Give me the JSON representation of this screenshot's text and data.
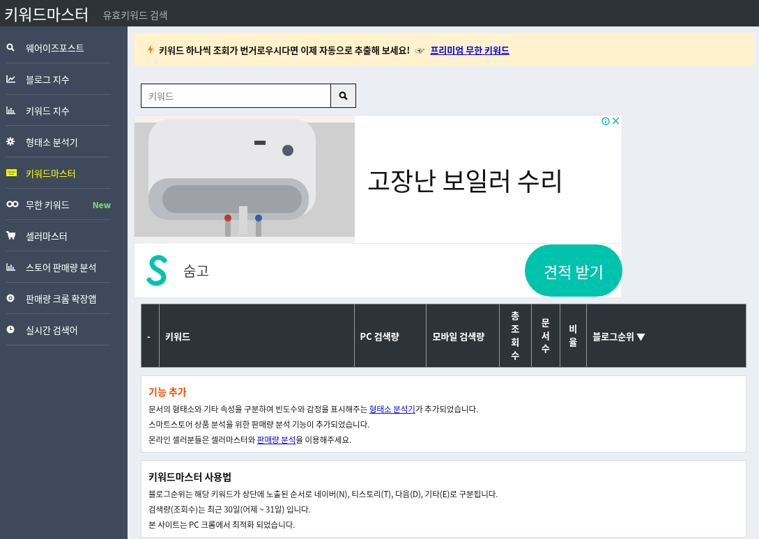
{
  "header": {
    "title": "키워드마스터",
    "subtitle": "유효키워드 검색"
  },
  "sidebar": {
    "items": [
      {
        "label": "웨어이즈포스트",
        "selected": false
      },
      {
        "label": "블로그 지수",
        "selected": false
      },
      {
        "label": "키워드 지수",
        "selected": false
      },
      {
        "label": "형태소 분석기",
        "selected": false
      },
      {
        "label": "키워드마스터",
        "selected": true
      },
      {
        "label": "무한 키워드",
        "selected": false,
        "badge": "New"
      },
      {
        "label": "셀러마스터",
        "selected": false
      },
      {
        "label": "스토어 판매량 분석",
        "selected": false
      },
      {
        "label": "판매량 크롬 확장앱",
        "selected": false
      },
      {
        "label": "실시간 검색어",
        "selected": false
      }
    ]
  },
  "banner": {
    "text": "키워드 하나씩 조회가 번거로우시다면 이제 자동으로 추출해 보세요!",
    "pointer": "☞",
    "link": "프리미엄 무한 키워드"
  },
  "search": {
    "placeholder": "키워드"
  },
  "ad": {
    "headline": "고장난 보일러 수리",
    "brand": "숨고",
    "button": "견적 받기"
  },
  "table": {
    "columns": [
      {
        "label": "-",
        "vertical": false
      },
      {
        "label": "키워드",
        "vertical": false
      },
      {
        "label": "PC 검색량",
        "vertical": false
      },
      {
        "label": "모바일 검색량",
        "vertical": false
      },
      {
        "label": "총조회수",
        "vertical": true
      },
      {
        "label": "문서수",
        "vertical": true
      },
      {
        "label": "비율",
        "vertical": true
      },
      {
        "label": "블로그순위",
        "vertical": false,
        "sort": "▼"
      }
    ]
  },
  "notices": [
    {
      "title": "기능 추가",
      "kind": "accent",
      "lines": [
        [
          {
            "kind": "text",
            "text": "문서의 형태소와 기타 속성을 구분하여 빈도수와 감정을 표시해주는 "
          },
          {
            "kind": "link",
            "text": "형태소 분석기"
          },
          {
            "kind": "text",
            "text": "가 추가되었습니다."
          }
        ],
        [
          {
            "kind": "text",
            "text": "스마트스토어 상품 분석을 위한 판매량 분석 기능이 추가되었습니다."
          }
        ],
        [
          {
            "kind": "text",
            "text": "온라인 셀러분들은 셀러마스터와 "
          },
          {
            "kind": "link",
            "text": "판매량 분석"
          },
          {
            "kind": "text",
            "text": "을 이용해주세요."
          }
        ]
      ]
    },
    {
      "title": "키워드마스터 사용법",
      "kind": "plain",
      "lines": [
        [
          {
            "kind": "text",
            "text": "블로그순위는 해당 키워드가 상단에 노출된 순서로 네이버(N), 티스토리(T), 다음(D), 기타(E)로 구분됩니다."
          }
        ],
        [
          {
            "kind": "text",
            "text": "검색량(조회수)는 최근 30일(어제 ~ 31일) 입니다."
          }
        ],
        [
          {
            "kind": "text",
            "text": "본 사이트는 PC 크롬에서 최적화 되었습니다."
          }
        ]
      ]
    }
  ]
}
